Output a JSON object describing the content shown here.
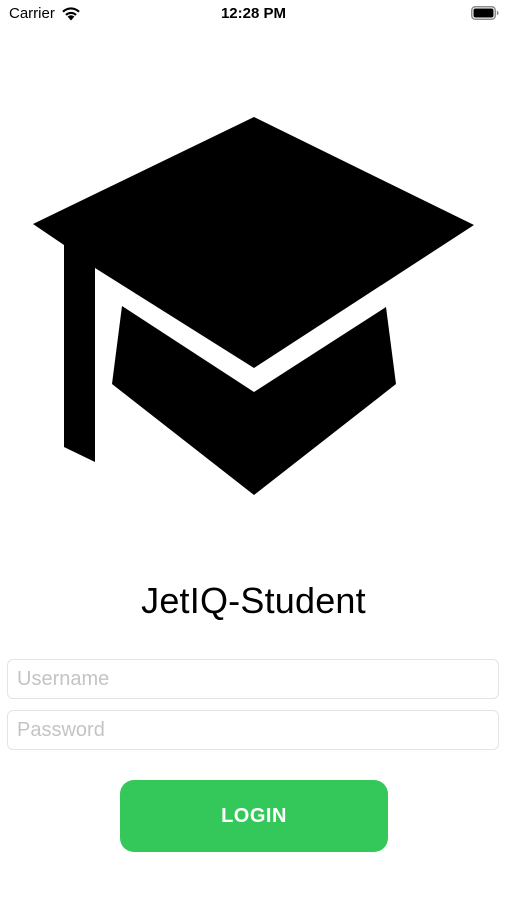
{
  "status_bar": {
    "carrier": "Carrier",
    "time": "12:28 PM",
    "wifi_icon": "wifi-icon",
    "battery_icon": "battery-icon"
  },
  "logo": {
    "icon": "graduation-cap-icon"
  },
  "app": {
    "title": "JetIQ-Student"
  },
  "form": {
    "username": {
      "value": "",
      "placeholder": "Username"
    },
    "password": {
      "value": "",
      "placeholder": "Password"
    },
    "login_label": "LOGIN"
  },
  "colors": {
    "accent": "#34c759",
    "background": "#ffffff",
    "text": "#000000",
    "placeholder": "#c4c4c6"
  }
}
